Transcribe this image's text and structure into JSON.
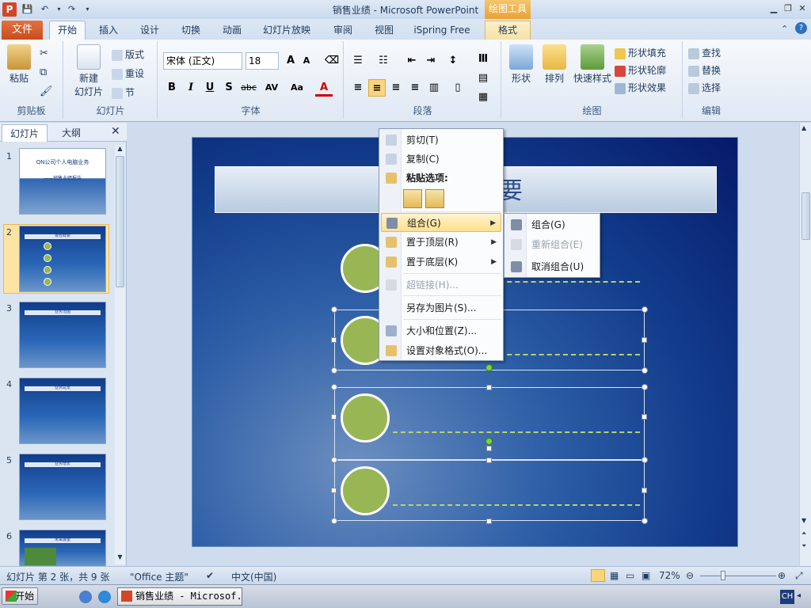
{
  "window": {
    "title": "销售业绩 - Microsoft PowerPoint",
    "app_icon": "P",
    "contextual_tab_group": "绘图工具",
    "controls": [
      "minimize-icon",
      "restore-icon",
      "close-icon"
    ]
  },
  "quick_access": [
    "save-icon",
    "undo-icon",
    "redo-icon",
    "customize-icon"
  ],
  "tabs": [
    {
      "label": "文件"
    },
    {
      "label": "开始"
    },
    {
      "label": "插入"
    },
    {
      "label": "设计"
    },
    {
      "label": "切换"
    },
    {
      "label": "动画"
    },
    {
      "label": "幻灯片放映"
    },
    {
      "label": "审阅"
    },
    {
      "label": "视图"
    },
    {
      "label": "iSpring Free"
    },
    {
      "label": "格式"
    }
  ],
  "ribbon": {
    "clipboard": {
      "label": "剪贴板",
      "paste": "粘贴"
    },
    "slides": {
      "label": "幻灯片",
      "new_slide_line1": "新建",
      "new_slide_line2": "幻灯片",
      "layout": "版式",
      "reset": "重设",
      "section": "节"
    },
    "font": {
      "label": "字体",
      "font_name": "宋体 (正文)",
      "font_size": "18",
      "bold": "B",
      "italic": "I",
      "underline": "U",
      "shadow": "S",
      "strike": "abc",
      "spacing": "AV",
      "case": "Aa",
      "color": "A",
      "grow": "A",
      "shrink": "A"
    },
    "paragraph": {
      "label": "段落"
    },
    "drawing": {
      "label": "绘图",
      "shapes": "形状",
      "arrange": "排列",
      "quick_styles": "快速样式",
      "fill": "形状填充",
      "outline": "形状轮廓",
      "effects": "形状效果"
    },
    "editing": {
      "label": "编辑",
      "find": "查找",
      "replace": "替换",
      "select": "选择"
    }
  },
  "panel": {
    "tab_slides": "幻灯片",
    "tab_outline": "大纲",
    "thumbnails": [
      {
        "num": "1",
        "title": "QN公司个人电脑业务",
        "subtitle": "——销售业绩报告"
      },
      {
        "num": "2",
        "title": "报告概要"
      },
      {
        "num": "3",
        "title": "业务范围"
      },
      {
        "num": "4",
        "title": "业务总览"
      },
      {
        "num": "5",
        "title": "业务增长"
      },
      {
        "num": "6",
        "title": "未来展望"
      }
    ]
  },
  "slide": {
    "title_fragment": "要"
  },
  "context_menu": {
    "items": [
      {
        "label": "剪切(T)",
        "icon": "cut-icon",
        "disabled": false
      },
      {
        "label": "复制(C)",
        "icon": "copy-icon",
        "disabled": false
      },
      {
        "label": "粘贴选项:",
        "icon": "paste-icon",
        "disabled": false,
        "header": true
      },
      {
        "label": "组合(G)",
        "icon": "group-icon",
        "disabled": false,
        "submenu": true,
        "highlighted": true
      },
      {
        "label": "置于顶层(R)",
        "icon": "bring-front-icon",
        "disabled": false,
        "submenu": true
      },
      {
        "label": "置于底层(K)",
        "icon": "send-back-icon",
        "disabled": false,
        "submenu": true
      },
      {
        "label": "超链接(H)...",
        "icon": "hyperlink-icon",
        "disabled": true
      },
      {
        "label": "另存为图片(S)...",
        "icon": "",
        "disabled": false
      },
      {
        "label": "大小和位置(Z)...",
        "icon": "size-position-icon",
        "disabled": false
      },
      {
        "label": "设置对象格式(O)...",
        "icon": "format-object-icon",
        "disabled": false
      }
    ]
  },
  "submenu": {
    "items": [
      {
        "label": "组合(G)",
        "disabled": false
      },
      {
        "label": "重新组合(E)",
        "disabled": true
      },
      {
        "label": "取消组合(U)",
        "disabled": false
      }
    ]
  },
  "status": {
    "slide_info": "幻灯片 第 2 张，共 9 张",
    "theme": "\"Office 主题\"",
    "language": "中文(中国)",
    "zoom": "72%"
  },
  "taskbar": {
    "start": "开始",
    "task": "销售业绩 - Microsof...",
    "ime": "CH"
  },
  "colors": {
    "accent_file_tab": "#d24726",
    "highlight_menu": "#ffe08f",
    "circle_fill": "#98b654"
  }
}
